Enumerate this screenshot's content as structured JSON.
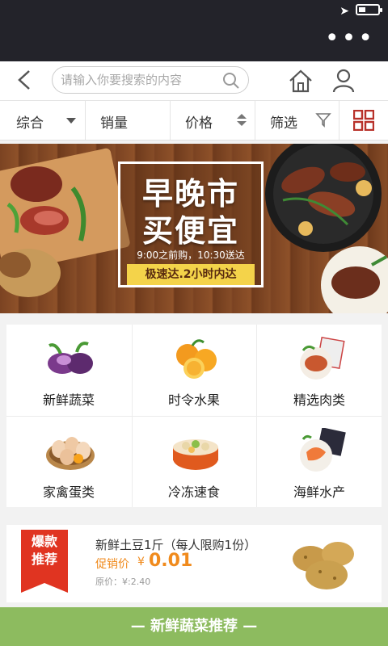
{
  "search": {
    "placeholder": "请输入你要搜索的内容"
  },
  "filters": [
    {
      "label": "综合"
    },
    {
      "label": "销量"
    },
    {
      "label": "价格"
    },
    {
      "label": "筛选"
    }
  ],
  "banner": {
    "title_line1": "早晚市",
    "title_line2": "买便宜",
    "subtitle": "9:00之前购，10:30送达",
    "tag": "极速达.2小时内达"
  },
  "categories": [
    {
      "label": "新鲜蔬菜",
      "icon": "vegetables-icon"
    },
    {
      "label": "时令水果",
      "icon": "fruit-icon"
    },
    {
      "label": "精选肉类",
      "icon": "meat-icon"
    },
    {
      "label": "家禽蛋类",
      "icon": "eggs-icon"
    },
    {
      "label": "冷冻速食",
      "icon": "frozen-food-icon"
    },
    {
      "label": "海鲜水产",
      "icon": "seafood-icon"
    }
  ],
  "promo": {
    "ribbon_line1": "爆款",
    "ribbon_line2": "推荐",
    "title": "新鲜土豆1斤（每人限购1份）",
    "sale_label": "促销价",
    "currency": "¥",
    "sale_price": "0.01",
    "original_price": "原价：¥:2.40"
  },
  "section_bar": {
    "label": "— 新鲜蔬菜推荐 —"
  },
  "colors": {
    "accent": "#e03421",
    "price": "#f08a1c",
    "green_bar": "#8dbb5f"
  }
}
